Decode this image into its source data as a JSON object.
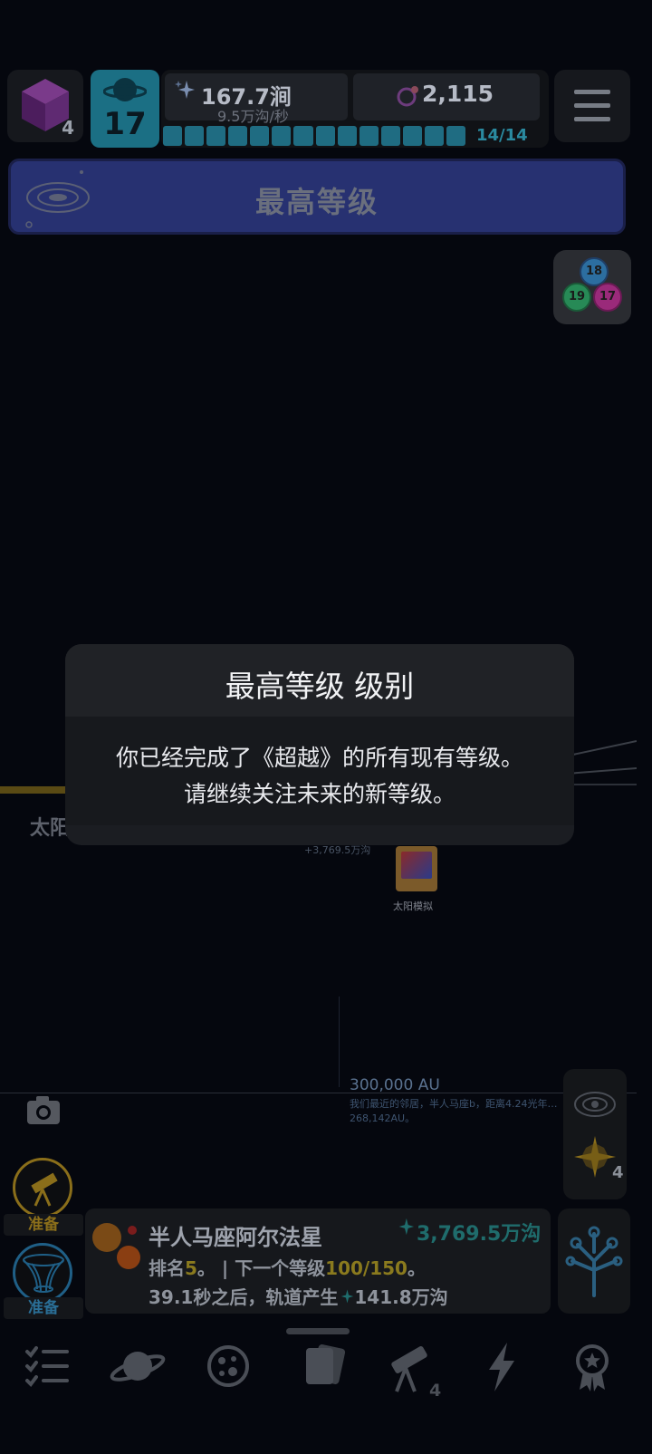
{
  "top_bar": {
    "cube_count": "4",
    "level": "17",
    "money": "167.7涧",
    "money_rate": "9.5万沟/秒",
    "gems": "2,115",
    "progress_text": "14/14",
    "progress_fraction": 1.0,
    "progress_segments": 14
  },
  "banner": {
    "title": "最高等级"
  },
  "prestige": {
    "bubbles": [
      "18",
      "19",
      "17"
    ]
  },
  "dialog": {
    "title": "最高等级 级别",
    "line1": "你已经完成了《超越》的所有现有等级。",
    "line2": "请继续关注未来的新等级。"
  },
  "scene": {
    "sun_label": "太阳",
    "tiny_amount": "+3,769.5万沟",
    "sim_label": "太阳模拟",
    "distance": "300,000 AU",
    "distance_note1": "我们最近的邻居，半人马座b，距离4.24光年…",
    "distance_note2": "268,142AU。"
  },
  "right_stack": {
    "star_count": "4"
  },
  "left_actions": {
    "telescope_label": "准备",
    "warp_label": "准备"
  },
  "star_card": {
    "name": "半人马座阿尔法星",
    "value": "3,769.5万沟",
    "rank_prefix": "排名",
    "rank": "5",
    "rank_suffix": "。 | 下一个等级",
    "next_level": "100/150",
    "rank_end": "。",
    "orbit_text": "39.1秒之后，轨道产生",
    "orbit_value": "141.8万沟"
  },
  "bottom_nav": {
    "telescope_count": "4"
  },
  "colors": {
    "banner": "#273171",
    "level_tile": "#1b6f84",
    "gold": "#8a7a1e",
    "teal": "#1f6c6c"
  },
  "icons": [
    "cube-icon",
    "planet-icon",
    "sparkle-icon",
    "gem-icon",
    "menu-icon",
    "galaxy-icon",
    "camera-icon",
    "galaxy-orbit-icon",
    "star-icon",
    "telescope-icon",
    "wormhole-icon",
    "tree-icon",
    "list-icon",
    "planet-nav-icon",
    "moon-icon",
    "cards-icon",
    "telescope-nav-icon",
    "lightning-icon",
    "award-icon"
  ]
}
